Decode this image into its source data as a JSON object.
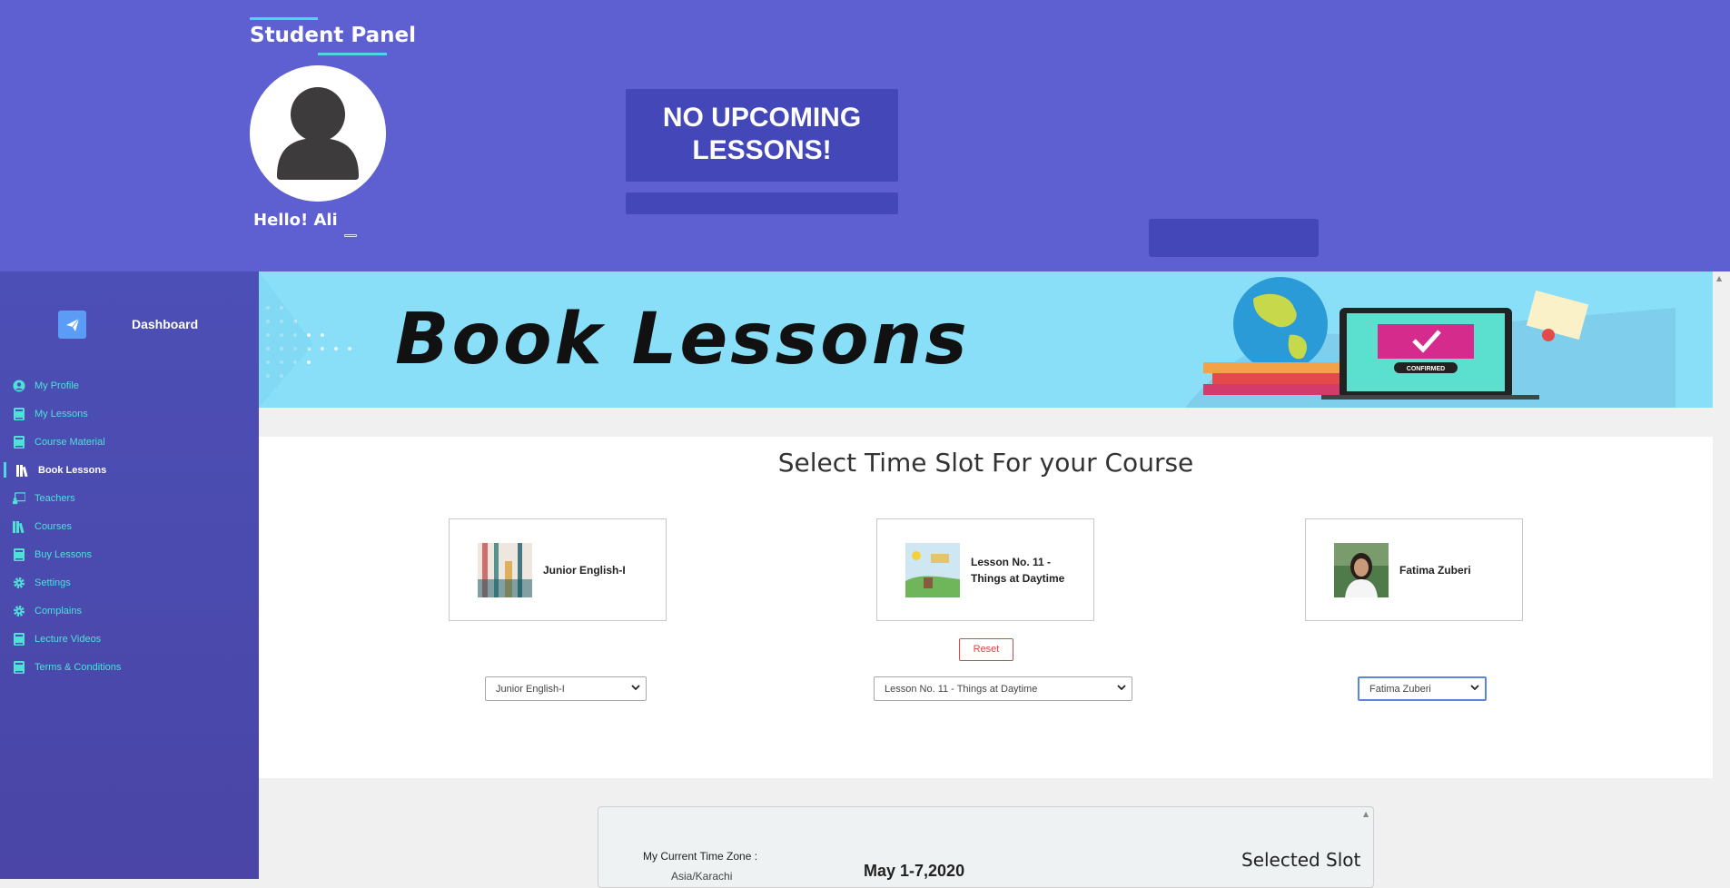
{
  "header": {
    "panel_title": "Student Panel",
    "greeting": "Hello!  Ali",
    "upcoming_text": "NO UPCOMING LESSONS!"
  },
  "sidebar": {
    "dashboard_label": "Dashboard",
    "items": [
      {
        "label": "My Profile",
        "icon": "user-circle-icon"
      },
      {
        "label": "My Lessons",
        "icon": "book-icon"
      },
      {
        "label": "Course Material",
        "icon": "book-icon"
      },
      {
        "label": "Book Lessons",
        "icon": "books-icon",
        "active": true
      },
      {
        "label": "Teachers",
        "icon": "chalkboard-teacher-icon"
      },
      {
        "label": "Courses",
        "icon": "books-icon"
      },
      {
        "label": "Buy Lessons",
        "icon": "book-icon"
      },
      {
        "label": "Settings",
        "icon": "gear-icon"
      },
      {
        "label": "Complains",
        "icon": "gear-icon"
      },
      {
        "label": "Lecture Videos",
        "icon": "book-icon"
      },
      {
        "label": "Terms & Conditions",
        "icon": "book-icon"
      }
    ]
  },
  "banner": {
    "title": "Book Lessons",
    "stamp_text": "CONFIRMED"
  },
  "slot_section": {
    "title": "Select Time Slot For your Course",
    "cards": [
      {
        "name": "Junior English-I"
      },
      {
        "name": "Lesson No. 11 - Things at Daytime"
      },
      {
        "name": "Fatima Zuberi"
      }
    ],
    "reset_label": "Reset",
    "selects": [
      {
        "value": "Junior English-I"
      },
      {
        "value": "Lesson No. 11 - Things at Daytime"
      },
      {
        "value": "Fatima Zuberi"
      }
    ]
  },
  "timezone": {
    "label": "My Current Time Zone :",
    "value": "Asia/Karachi",
    "week": "May 1-7,2020",
    "selected_slot_label": "Selected Slot"
  },
  "colors": {
    "header_bg": "#5e60d2",
    "accent_dark": "#4447b8",
    "sidebar_text": "#4fe0d8",
    "banner_bg": "#8adff8",
    "reset": "#e04444"
  }
}
